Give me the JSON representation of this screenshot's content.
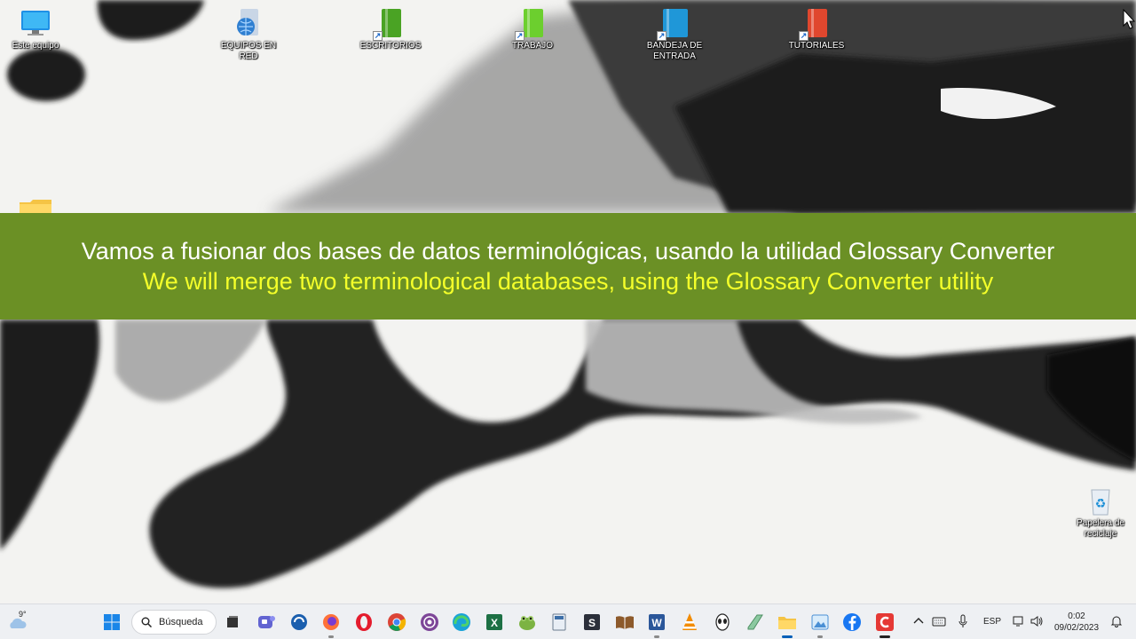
{
  "desktop": {
    "icons": [
      {
        "label": "Este equipo",
        "icon": "computer-icon"
      },
      {
        "label": "EQUIPOS EN RED",
        "icon": "network-icon"
      },
      {
        "label": "ESCRITORIOS",
        "icon": "green-book-icon"
      },
      {
        "label": "TRABAJO",
        "icon": "green-book-icon"
      },
      {
        "label": "BANDEJA DE ENTRADA",
        "icon": "blue-book-icon"
      },
      {
        "label": "TUTORIALES",
        "icon": "red-book-icon"
      },
      {
        "label": "Papelera de reciclaje",
        "icon": "recycle-bin-icon"
      }
    ]
  },
  "subtitle": {
    "line_es": "Vamos a fusionar dos bases de datos terminológicas, usando la utilidad Glossary Converter",
    "line_en": "We will merge two terminological databases, using the Glossary Converter utility"
  },
  "taskbar": {
    "weather_temp": "9°",
    "search_label": "Búsqueda",
    "apps": [
      "start-icon",
      "task-view-icon",
      "teams-icon",
      "app-blue-circle-icon",
      "firefox-icon",
      "opera-icon",
      "chrome-icon",
      "tor-icon",
      "edge-icon",
      "excel-icon",
      "frog-app-icon",
      "calculator-icon",
      "sublime-icon",
      "book-reader-icon",
      "word-icon",
      "vlc-icon",
      "alien-app-icon",
      "green-notes-icon",
      "file-explorer-icon",
      "photos-icon",
      "facebook-icon",
      "red-app-icon"
    ],
    "language": "ESP",
    "time": "0:02",
    "date": "09/02/2023"
  },
  "colors": {
    "banner": "#6b9025",
    "subtitle_en": "#f4ff2a",
    "taskbar": "#eef0f3"
  }
}
